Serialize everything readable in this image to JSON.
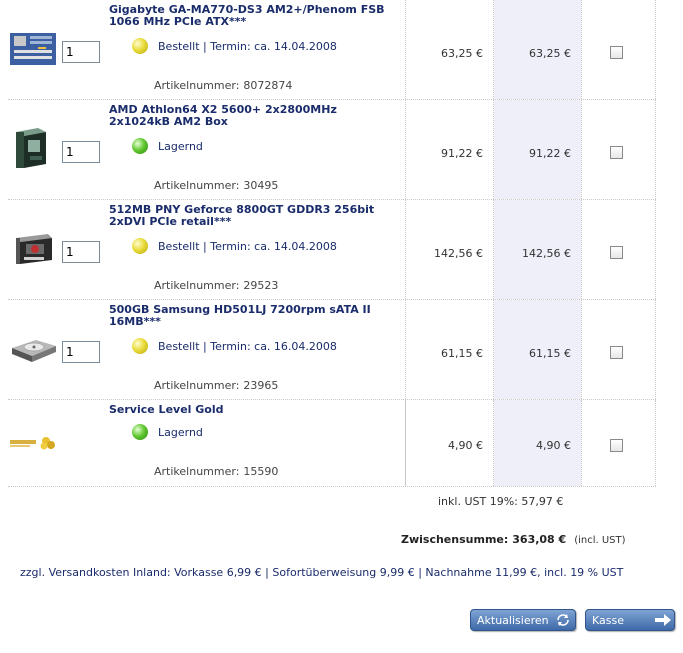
{
  "cart": {
    "items": [
      {
        "title": "Gigabyte GA-MA770-DS3 AM2+/Phenom FSB 1066 MHz PCIe ATX***",
        "qty": "1",
        "status": "yellow",
        "status_text": "Bestellt | Termin: ca. 14.04.2008",
        "artnr_label": "Artikelnummer:",
        "artnr": "8072874",
        "price": "63,25 €",
        "total": "63,25 €",
        "thumb_icon": "motherboard-icon"
      },
      {
        "title": "AMD Athlon64 X2 5600+ 2x2800MHz 2x1024kB AM2 Box",
        "qty": "1",
        "status": "green",
        "status_text": "Lagernd",
        "artnr_label": "Artikelnummer:",
        "artnr": "30495",
        "price": "91,22 €",
        "total": "91,22 €",
        "thumb_icon": "cpu-box-icon"
      },
      {
        "title": "512MB PNY Geforce 8800GT GDDR3 256bit 2xDVI PCIe retail***",
        "qty": "1",
        "status": "yellow",
        "status_text": "Bestellt | Termin: ca. 14.04.2008",
        "artnr_label": "Artikelnummer:",
        "artnr": "29523",
        "price": "142,56 €",
        "total": "142,56 €",
        "thumb_icon": "graphics-card-box-icon"
      },
      {
        "title": "500GB Samsung HD501LJ 7200rpm sATA II 16MB***",
        "qty": "1",
        "status": "yellow",
        "status_text": "Bestellt | Termin: ca. 16.04.2008",
        "artnr_label": "Artikelnummer:",
        "artnr": "23965",
        "price": "61,15 €",
        "total": "61,15 €",
        "thumb_icon": "hard-drive-icon"
      },
      {
        "title": "Service Level Gold",
        "status": "green",
        "status_text": "Lagernd",
        "artnr_label": "Artikelnummer:",
        "artnr": "15590",
        "price": "4,90 €",
        "total": "4,90 €",
        "thumb_icon": "service-gold-icon"
      }
    ],
    "ust_text": "inkl. UST 19%: 57,97 €",
    "subtotal_label": "Zwischensumme:",
    "subtotal_value": "363,08 €",
    "subtotal_note": "(incl. UST)",
    "shipping_text": "zzgl. Versandkosten Inland: Vorkasse 6,99 € | Sofortüberweisung 9,99 € | Nachnahme 11,99 €, incl. 19 % UST"
  },
  "buttons": {
    "update_label": "Aktualisieren",
    "checkout_label": "Kasse"
  },
  "colors": {
    "title_blue": "#1a2c6b",
    "highlight_column": "#efeffa",
    "button_blue": "#3f6aa8"
  }
}
